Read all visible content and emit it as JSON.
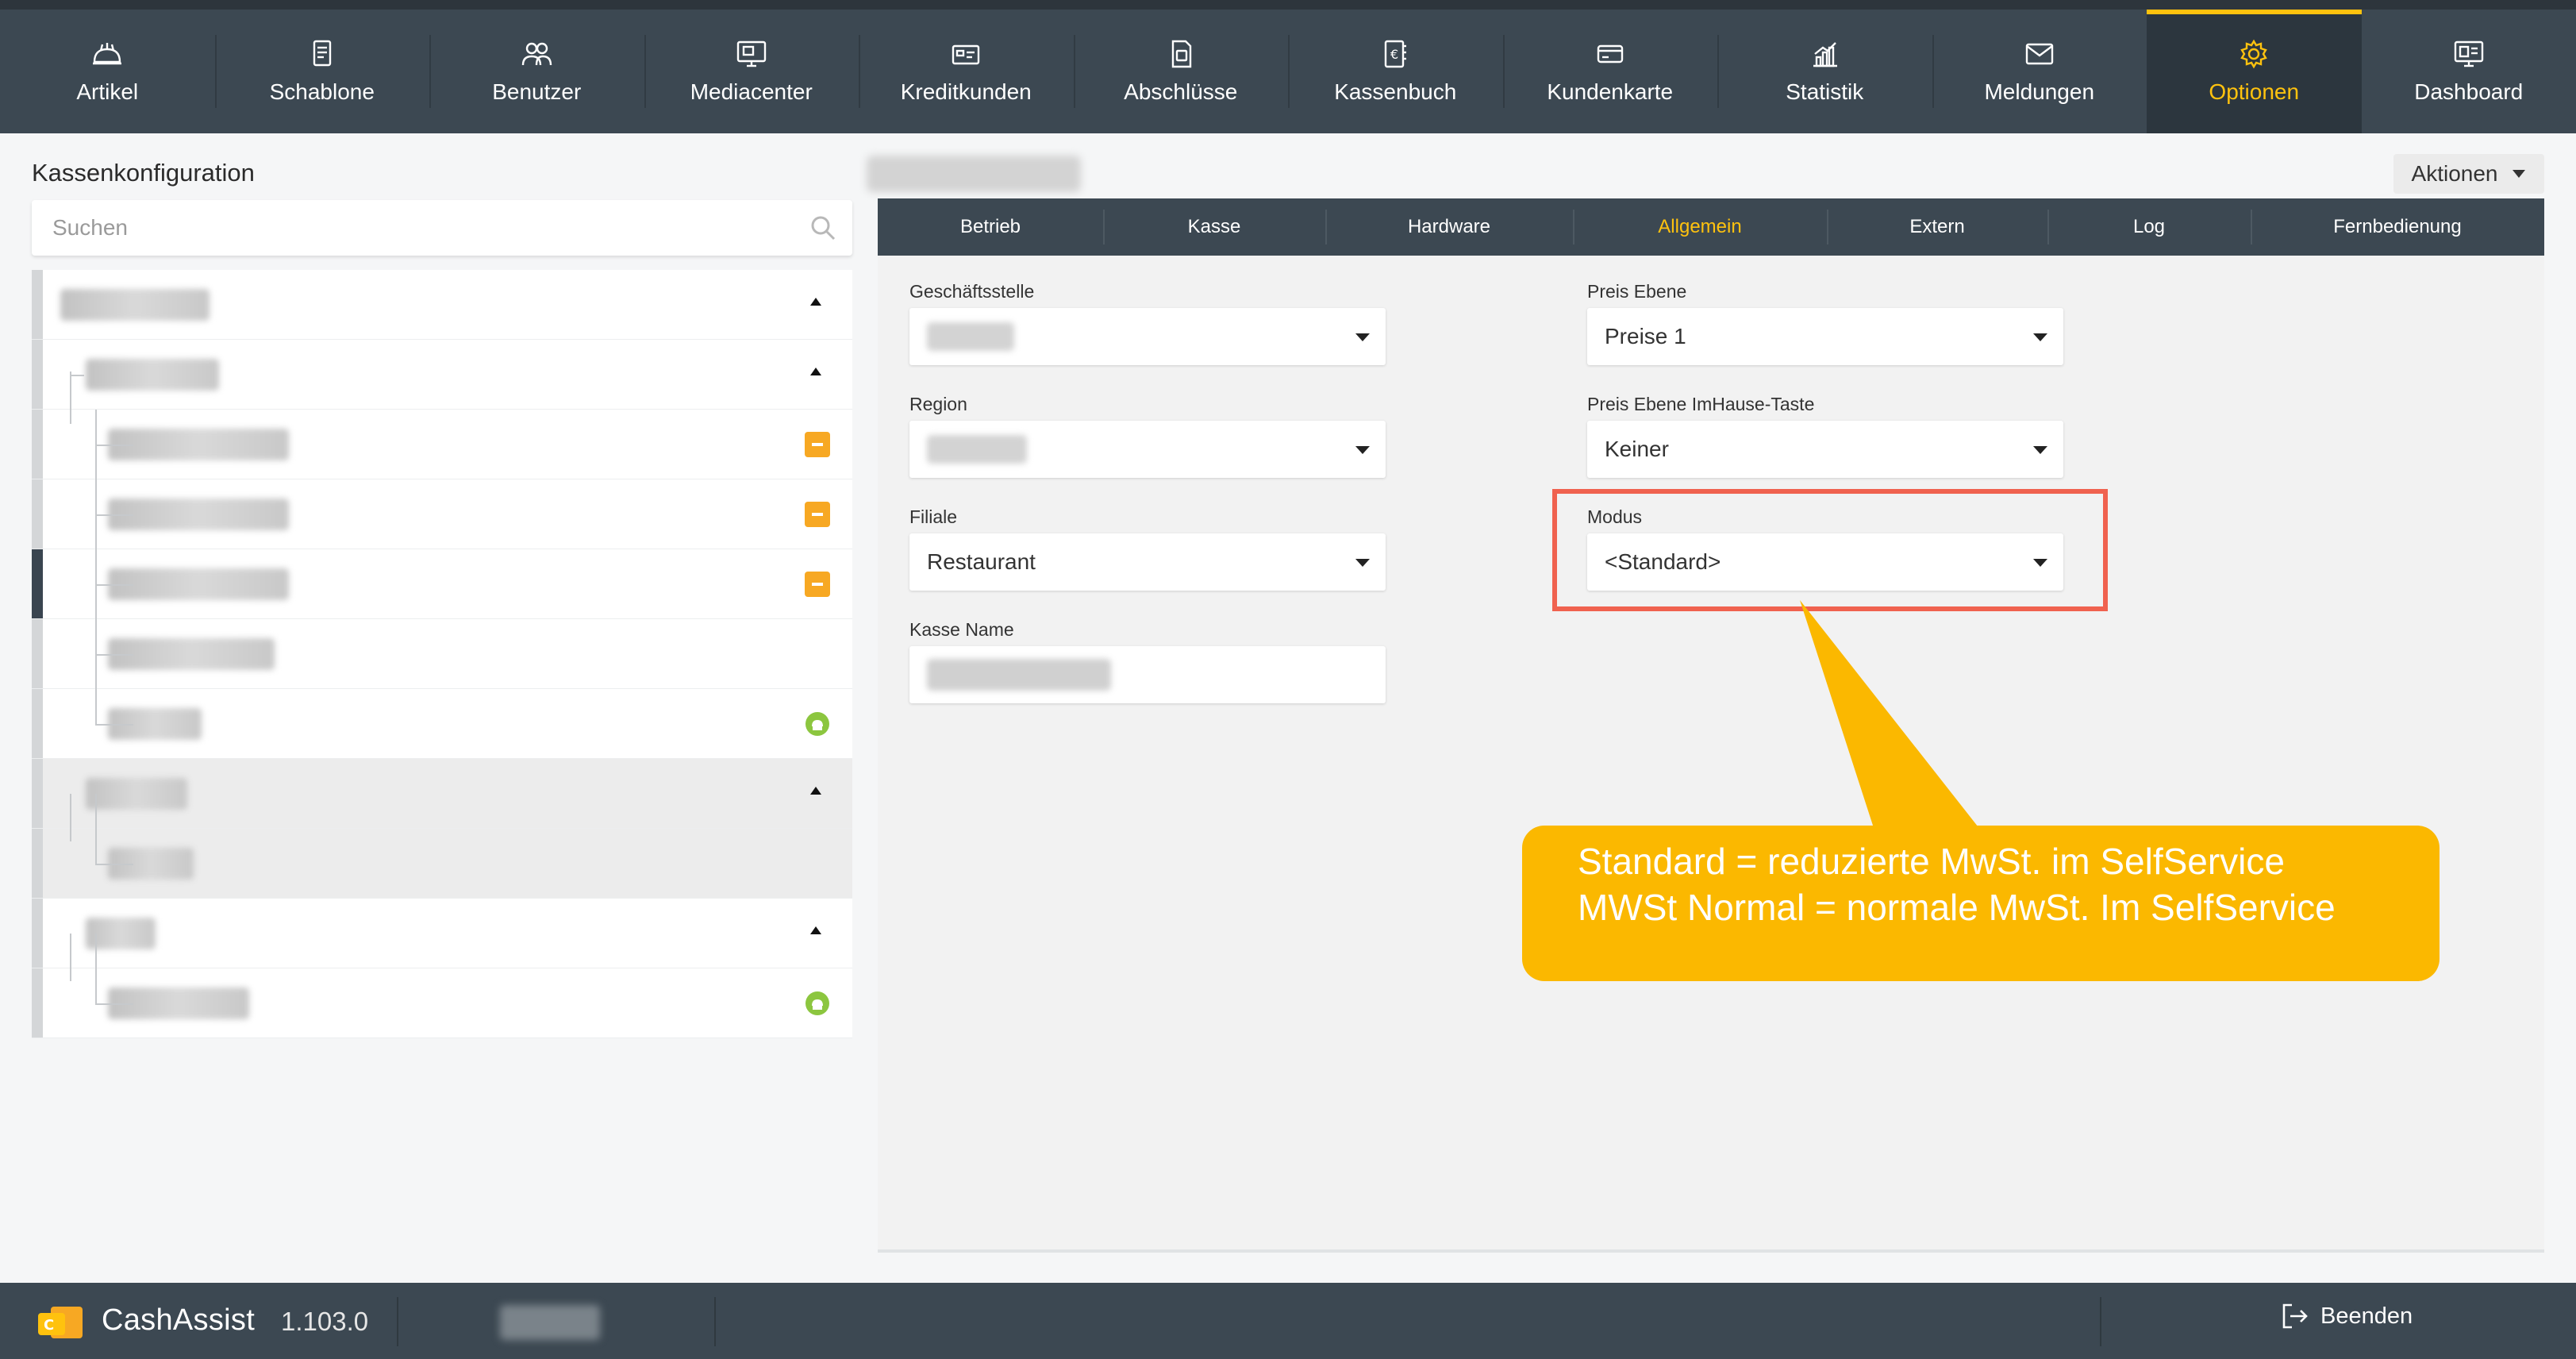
{
  "nav": {
    "items": [
      {
        "label": "Artikel",
        "icon": "bread-icon"
      },
      {
        "label": "Schablone",
        "icon": "template-icon"
      },
      {
        "label": "Benutzer",
        "icon": "users-icon"
      },
      {
        "label": "Mediacenter",
        "icon": "monitor-icon"
      },
      {
        "label": "Kreditkunden",
        "icon": "credit-card-icon"
      },
      {
        "label": "Abschlüsse",
        "icon": "document-icon"
      },
      {
        "label": "Kassenbuch",
        "icon": "cashbook-icon"
      },
      {
        "label": "Kundenkarte",
        "icon": "card-icon"
      },
      {
        "label": "Statistik",
        "icon": "chart-icon"
      },
      {
        "label": "Meldungen",
        "icon": "mail-icon"
      },
      {
        "label": "Optionen",
        "icon": "gear-icon"
      },
      {
        "label": "Dashboard",
        "icon": "dashboard-icon"
      }
    ],
    "active": "Optionen"
  },
  "left": {
    "title": "Kassenkonfiguration",
    "search_placeholder": "Suchen"
  },
  "actions_label": "Aktionen",
  "tabs": [
    "Betrieb",
    "Kasse",
    "Hardware",
    "Allgemein",
    "Extern",
    "Log",
    "Fernbedienung"
  ],
  "active_tab": "Allgemein",
  "form": {
    "geschaeftsstelle_label": "Geschäftsstelle",
    "region_label": "Region",
    "filiale_label": "Filiale",
    "filiale_value": "Restaurant",
    "kasse_name_label": "Kasse Name",
    "preis_ebene_label": "Preis Ebene",
    "preis_ebene_value": "Preise 1",
    "preis_imhause_label": "Preis Ebene ImHause-Taste",
    "preis_imhause_value": "Keiner",
    "modus_label": "Modus",
    "modus_value": "<Standard>"
  },
  "callout": {
    "line1": "Standard = reduzierte MwSt. im SelfService",
    "line2": "MWSt Normal = normale MwSt. Im SelfService"
  },
  "footer": {
    "brand": "CashAssist",
    "version": "1.103.0",
    "logout_label": "Beenden"
  },
  "colors": {
    "nav_bg": "#3c4852",
    "accent": "#ffc20e",
    "callout": "#fbb800",
    "highlight": "#f0624f"
  }
}
